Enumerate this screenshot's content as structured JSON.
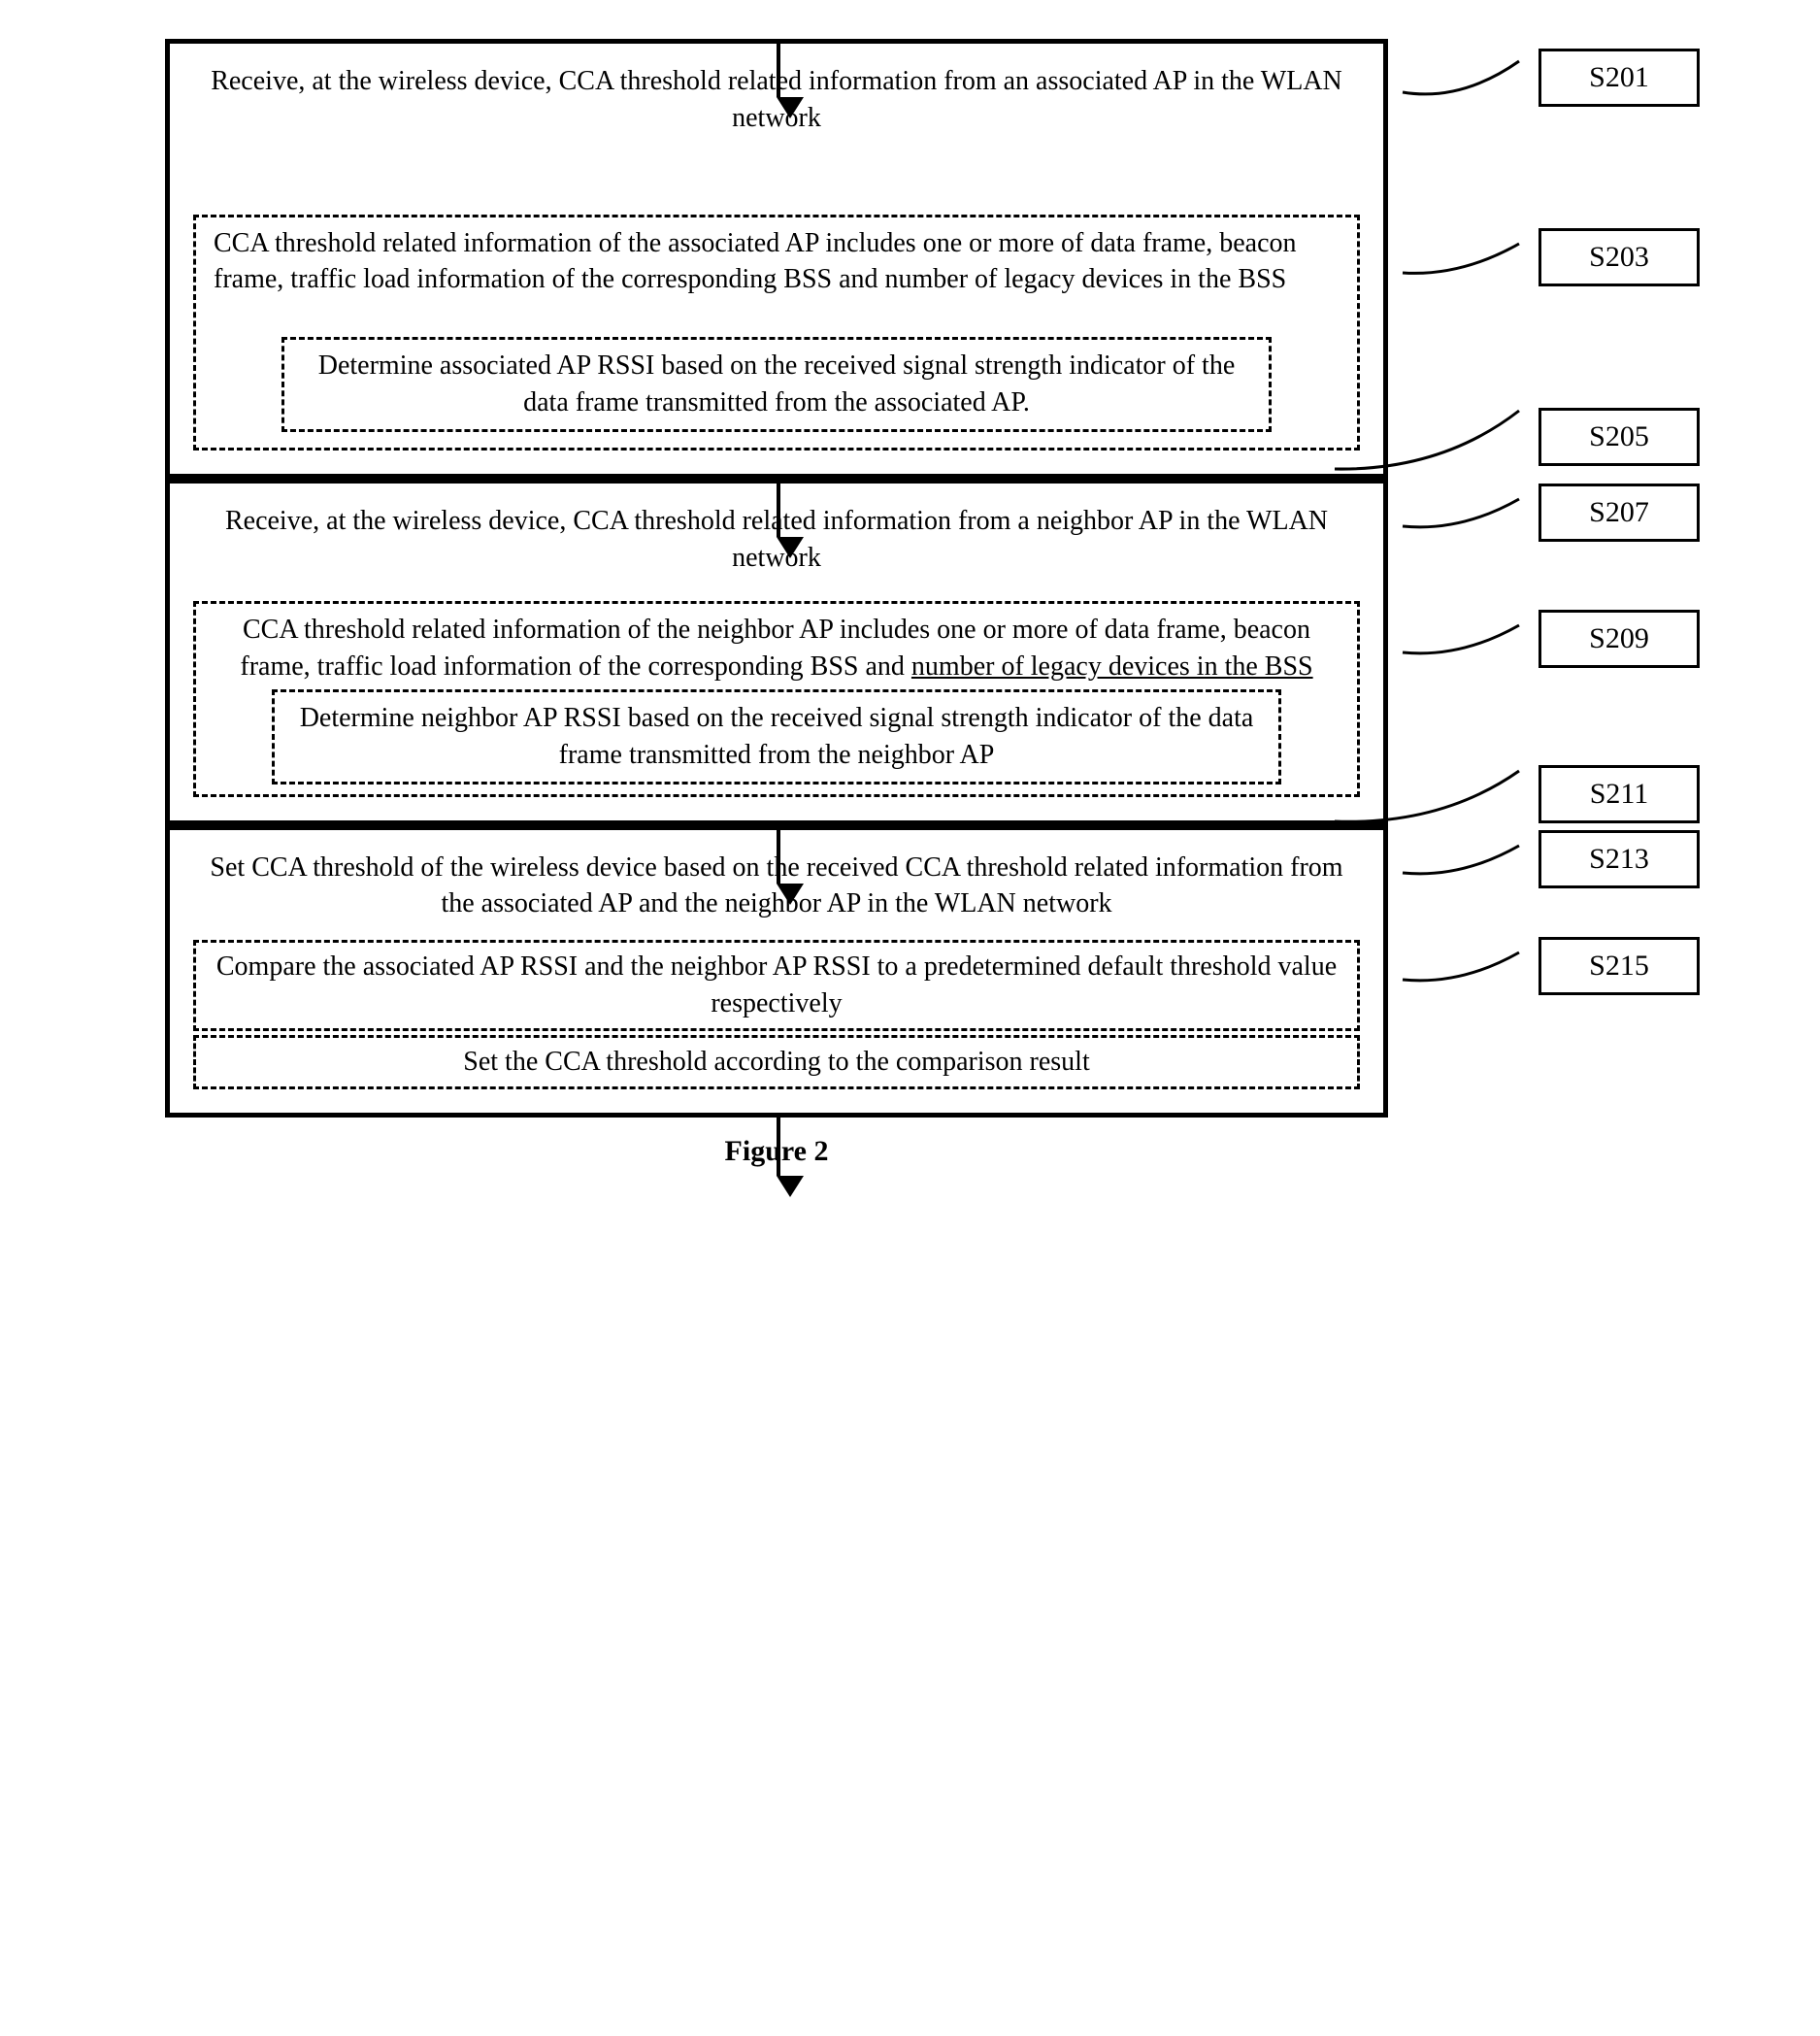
{
  "steps": {
    "s201": "Receive, at the wireless device, CCA threshold related information from an associated AP in the WLAN network",
    "s203": "CCA threshold related information of the associated AP includes one or more of data frame, beacon frame, traffic load information of the corresponding BSS and number of legacy devices in the BSS",
    "s205": "Determine associated AP RSSI based on the received signal strength indicator of the data frame transmitted from the associated AP.",
    "s207": "Receive, at the wireless device, CCA threshold related information from a neighbor AP in the WLAN network",
    "s209_a": "CCA threshold related information of the neighbor AP includes one or more of data frame, beacon frame, traffic load information of the corresponding BSS and ",
    "s209_b": "number of legacy devices in the BSS",
    "s211": "Determine neighbor AP RSSI based on the received signal strength indicator of the data frame transmitted from the neighbor AP",
    "s213": "Set CCA threshold of the wireless device based on the received CCA threshold related information from the associated AP and the neighbor AP in the WLAN network",
    "s215": "Compare the associated AP RSSI and the neighbor AP RSSI to a predetermined default threshold value respectively",
    "s215b": "Set the CCA threshold according to the comparison result"
  },
  "labels": {
    "s201": "S201",
    "s203": "S203",
    "s205": "S205",
    "s207": "S207",
    "s209": "S209",
    "s211": "S211",
    "s213": "S213",
    "s215": "S215"
  },
  "caption": "Figure 2"
}
